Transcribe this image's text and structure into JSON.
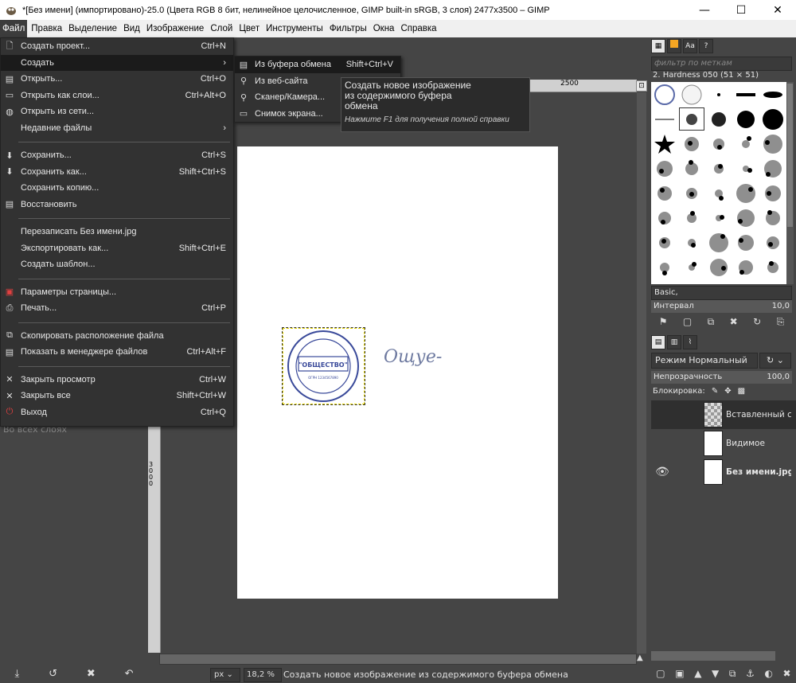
{
  "window": {
    "title": "*[Без имени] (импортировано)-25.0 (Цвета RGB 8 бит, нелинейное целочисленное, GIMP built-in sRGB, 3 слоя) 2477x3500 – GIMP",
    "minimize": "—",
    "maximize": "☐",
    "close": "✕"
  },
  "menubar": {
    "items": [
      "Файл",
      "Правка",
      "Выделение",
      "Вид",
      "Изображение",
      "Слой",
      "Цвет",
      "Инструменты",
      "Фильтры",
      "Окна",
      "Справка"
    ]
  },
  "file_menu": {
    "items": [
      {
        "label": "Создать проект...",
        "shortcut": "Ctrl+N",
        "icon": "new-file-icon"
      },
      {
        "label": "Создать",
        "shortcut": "",
        "icon": "",
        "submenu": true
      },
      {
        "label": "Открыть...",
        "shortcut": "Ctrl+O",
        "icon": "open-icon"
      },
      {
        "label": "Открыть как слои...",
        "shortcut": "Ctrl+Alt+O",
        "icon": "open-layers-icon"
      },
      {
        "label": "Открыть из сети...",
        "shortcut": "",
        "icon": "globe-icon"
      },
      {
        "label": "Недавние файлы",
        "shortcut": "",
        "icon": "",
        "submenu": true
      },
      {
        "label": "Сохранить...",
        "shortcut": "Ctrl+S",
        "icon": "save-icon"
      },
      {
        "label": "Сохранить как...",
        "shortcut": "Shift+Ctrl+S",
        "icon": "save-as-icon"
      },
      {
        "label": "Сохранить копию...",
        "shortcut": "",
        "icon": ""
      },
      {
        "label": "Восстановить",
        "shortcut": "",
        "icon": "revert-icon"
      },
      {
        "label": "Перезаписать Без имени.jpg",
        "shortcut": "",
        "icon": ""
      },
      {
        "label": "Экспортировать как...",
        "shortcut": "Shift+Ctrl+E",
        "icon": ""
      },
      {
        "label": "Создать шаблон...",
        "shortcut": "",
        "icon": ""
      },
      {
        "label": "Параметры страницы...",
        "shortcut": "",
        "icon": "page-setup-icon"
      },
      {
        "label": "Печать...",
        "shortcut": "Ctrl+P",
        "icon": "print-icon"
      },
      {
        "label": "Скопировать расположение файла",
        "shortcut": "",
        "icon": "copy-location-icon"
      },
      {
        "label": "Показать в менеджере файлов",
        "shortcut": "Ctrl+Alt+F",
        "icon": "file-manager-icon"
      },
      {
        "label": "Закрыть просмотр",
        "shortcut": "Ctrl+W",
        "icon": "close-view-icon"
      },
      {
        "label": "Закрыть все",
        "shortcut": "Shift+Ctrl+W",
        "icon": "close-all-icon"
      },
      {
        "label": "Выход",
        "shortcut": "Ctrl+Q",
        "icon": "quit-icon"
      }
    ]
  },
  "create_submenu": {
    "items": [
      {
        "label": "Из буфера обмена",
        "shortcut": "Shift+Ctrl+V"
      },
      {
        "label": "Из веб-сайта",
        "shortcut": ""
      },
      {
        "label": "Сканер/Камера...",
        "shortcut": ""
      },
      {
        "label": "Снимок экрана...",
        "shortcut": ""
      }
    ]
  },
  "tooltip": {
    "main": "Создать новое изображение\nиз содержимого буфера\nобмена",
    "help": "Нажмите F1 для получения полной справки"
  },
  "left_dock": {
    "layer_hint": "Во всех слоях"
  },
  "canvas": {
    "ruler_label": "2500",
    "ruler_left_digits": [
      "3",
      "0",
      "0",
      "0"
    ],
    "stamp_text": "\"ОБЩЕСТВО\"",
    "stamp_subtext": "ОГРН 1234567890",
    "signature": "Ощуе-"
  },
  "statusbar": {
    "unit": "px",
    "zoom": "18,2 %",
    "message": "Создать новое изображение из содержимого буфера обмена"
  },
  "right_dock": {
    "filter_placeholder": "фильтр по меткам",
    "brush_name": "2. Hardness 050 (51 × 51)",
    "preset": "Basic,",
    "interval_label": "Интервал",
    "interval_value": "10,0",
    "mode_label": "Режим",
    "mode_value": "Нормальный",
    "opacity_label": "Непрозрачность",
    "opacity_value": "100,0",
    "lock_label": "Блокировка:",
    "layers": [
      {
        "name": "Вставленный с",
        "visible": false,
        "checker": true,
        "bold": false,
        "active": true
      },
      {
        "name": "Видимое",
        "visible": false,
        "checker": false,
        "bold": false,
        "active": false
      },
      {
        "name": "Без имени.jpg",
        "visible": true,
        "checker": false,
        "bold": true,
        "active": false
      }
    ]
  }
}
